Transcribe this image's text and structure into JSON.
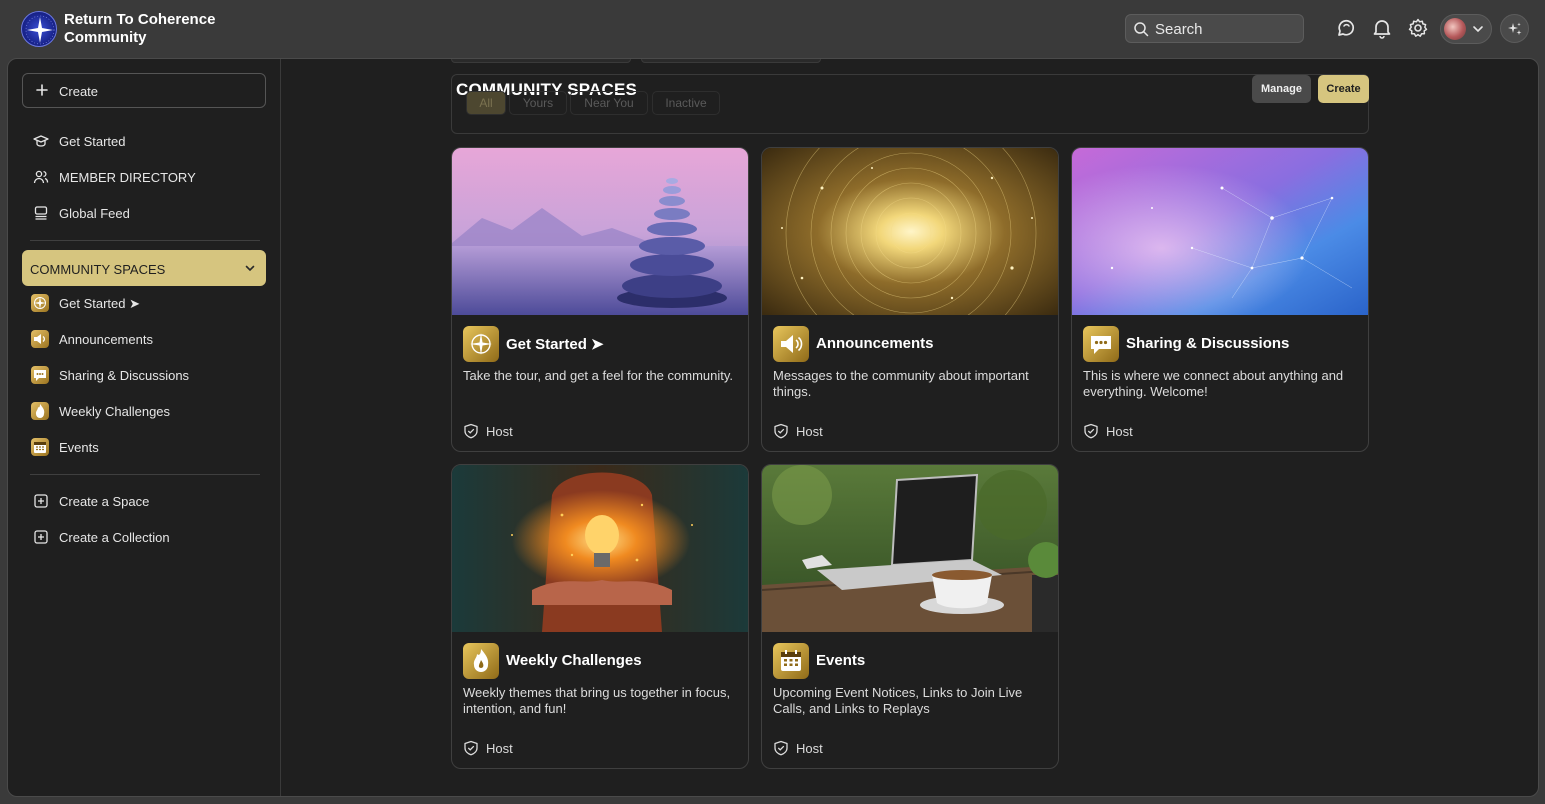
{
  "brand": {
    "line1": "Return To Coherence",
    "line2": "Community"
  },
  "topbar": {
    "search_placeholder": "Search",
    "icons": [
      "chat-icon",
      "bell-icon",
      "gear-icon",
      "avatar",
      "sparkle-icon"
    ]
  },
  "sidebar": {
    "create_label": "Create",
    "nav": [
      {
        "label": "Get Started",
        "icon": "graduation-cap-icon"
      },
      {
        "label": "MEMBER DIRECTORY",
        "icon": "people-icon"
      },
      {
        "label": "Global Feed",
        "icon": "feed-icon"
      }
    ],
    "section_label": "COMMUNITY SPACES",
    "spaces": [
      {
        "label": "Get Started ➤",
        "icon": "compass-icon"
      },
      {
        "label": "Announcements",
        "icon": "megaphone-icon"
      },
      {
        "label": "Sharing & Discussions",
        "icon": "speech-bubble-icon"
      },
      {
        "label": "Weekly Challenges",
        "icon": "flame-icon"
      },
      {
        "label": "Events",
        "icon": "calendar-icon"
      }
    ],
    "actions": [
      {
        "label": "Create a Space",
        "icon": "plus-square-icon"
      },
      {
        "label": "Create a Collection",
        "icon": "plus-square-icon"
      }
    ]
  },
  "main": {
    "title": "COMMUNITY SPACES",
    "filters": [
      "All",
      "Yours",
      "Near You",
      "Inactive"
    ],
    "active_filter": "All",
    "manage_label": "Manage",
    "create_label": "Create",
    "cards": [
      {
        "title": "Get Started ➤",
        "desc": "Take the tour, and get a feel for the community.",
        "role": "Host",
        "icon": "compass-icon"
      },
      {
        "title": "Announcements",
        "desc": "Messages to the community about important things.",
        "role": "Host",
        "icon": "megaphone-icon"
      },
      {
        "title": "Sharing & Discussions",
        "desc": "This is where we connect about anything and everything. Welcome!",
        "role": "Host",
        "icon": "speech-bubble-icon"
      },
      {
        "title": "Weekly Challenges",
        "desc": "Weekly themes that bring us together in focus, intention, and fun!",
        "role": "Host",
        "icon": "flame-icon"
      },
      {
        "title": "Events",
        "desc": "Upcoming Event Notices, Links to Join Live Calls, and Links to Replays",
        "role": "Host",
        "icon": "calendar-icon"
      }
    ]
  },
  "colors": {
    "accent": "#d6c57f",
    "background": "#1f1f1f",
    "topbar": "#3a3a3a"
  }
}
